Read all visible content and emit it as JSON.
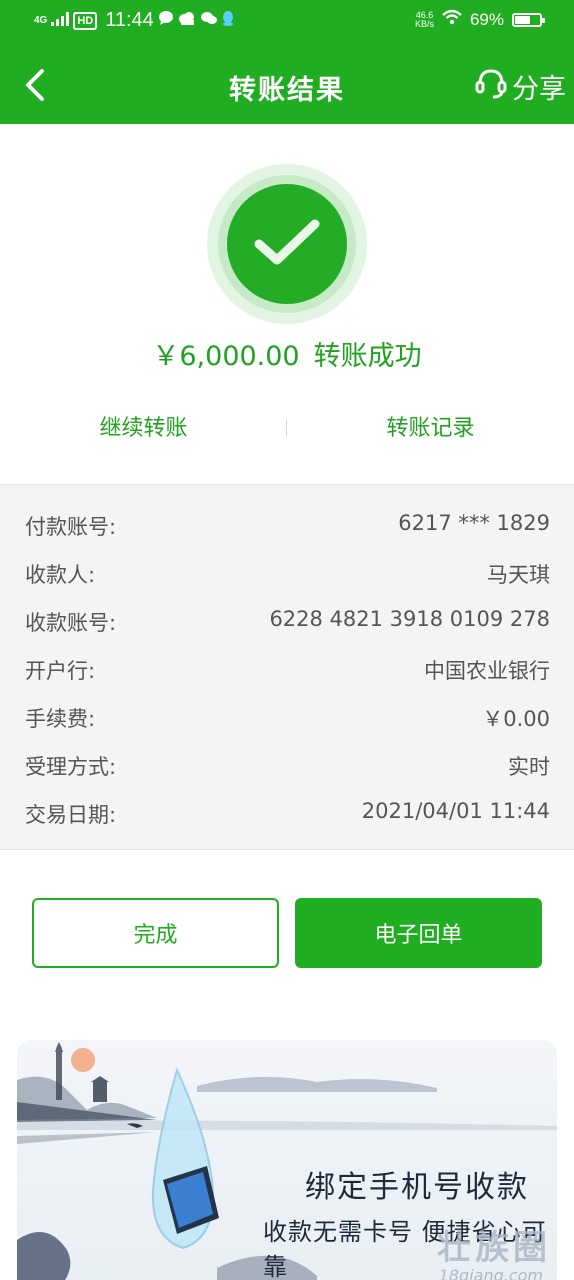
{
  "status_bar": {
    "signal": "4G",
    "hd": "HD",
    "time": "11:44",
    "net_speed_value": "46.6",
    "net_speed_unit": "KB/s",
    "battery": "69%",
    "battery_level": 0.69
  },
  "header": {
    "title": "转账结果",
    "share_label": "分享"
  },
  "result": {
    "amount": "￥6,000.00",
    "status_text": "转账成功",
    "continue_label": "继续转账",
    "records_label": "转账记录"
  },
  "details": [
    {
      "label": "付款账号:",
      "value": "6217 *** 1829"
    },
    {
      "label": "收款人:",
      "value": "马天琪"
    },
    {
      "label": "收款账号:",
      "value": "6228 4821 3918 0109 278"
    },
    {
      "label": "开户行:",
      "value": "中国农业银行"
    },
    {
      "label": "手续费:",
      "value": "￥0.00"
    },
    {
      "label": "受理方式:",
      "value": "实时"
    },
    {
      "label": "交易日期:",
      "value": "2021/04/01 11:44"
    }
  ],
  "buttons": {
    "done_label": "完成",
    "receipt_label": "电子回单"
  },
  "banner": {
    "line1": "绑定手机号收款",
    "line2": "收款无需卡号 便捷省心可靠",
    "watermark": "壮族圈",
    "watermark_sub": "18qiang.com"
  },
  "colors": {
    "brand_green": "#21ad21",
    "detail_bg": "#f4f4f4"
  }
}
